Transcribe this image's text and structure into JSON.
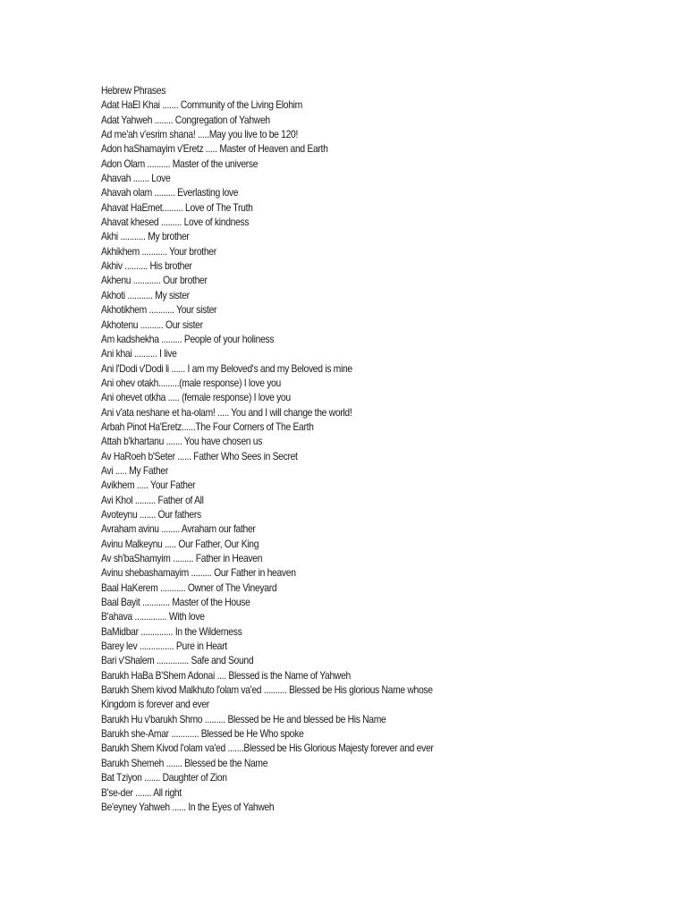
{
  "document": {
    "title": "Hebrew Phrases",
    "entries": [
      "Adat HaEl Khai ....... Community of the Living Elohim",
      "Adat Yahweh ........ Congregation of Yahweh",
      "Ad me'ah v'esrim shana! .....May you live to be 120!",
      "Adon haShamayim v'Eretz ..... Master of Heaven and Earth",
      "Adon Olam .......... Master of the universe",
      "Ahavah ....... Love",
      "Ahavah olam ......... Everlasting love",
      "Ahavat HaEmet......... Love of The Truth",
      "Ahavat khesed ......... Love of kindness",
      "Akhi ........... My brother",
      "Akhikhem ........... Your brother",
      "Akhiv .......... His brother",
      "Akhenu ............ Our brother",
      "Akhoti ........... My sister",
      "Akhotikhem ........... Your sister",
      "Akhotenu .......... Our sister",
      "Am kadshekha ......... People of your holiness",
      "Ani khai .......... I live",
      "Ani l'Dodi v'Dodi li ...... I am my Beloved's and my Beloved is mine",
      "Ani ohev otakh.........(male response) I love you",
      "Ani ohevet otkha ..... (female response) I love you",
      "Ani v'ata neshane et ha-olam! ..... You and I will change the world!",
      "Arbah Pinot Ha'Eretz......The Four Corners of The Earth",
      "Attah b'khartanu ....... You have chosen us",
      "Av HaRoeh b'Seter ...... Father Who Sees in Secret",
      "Avi ..... My Father",
      "Avikhem ..... Your Father",
      "Avi Khol ......... Father of All",
      "Avoteynu ....... Our fathers",
      "Avraham avinu ........ Avraham our father",
      "Avinu Malkeynu ..... Our Father, Our King",
      "Av sh'baShamyim ......... Father in Heaven",
      "Avinu shebashamayim ......... Our Father in heaven",
      "Baal HaKerem ........... Owner of The Vineyard",
      "Baal Bayit ............ Master of the House",
      "B'ahava .............. With love",
      "BaMidbar .............. In the Wilderness",
      "Barey lev ............... Pure in Heart",
      "Bari v'Shalem .............. Safe and Sound",
      "Barukh HaBa B'Shem Adonai .... Blessed is the Name of Yahweh",
      "Barukh Shem kivod Malkhuto l'olam va'ed .......... Blessed be His glorious Name whose Kingdom is forever and ever",
      "Barukh Hu v'barukh Shmo ......... Blessed be He and blessed be His Name",
      "Barukh she-Amar ............ Blessed be He Who spoke",
      "Barukh Shem Kivod l'olam va'ed .......Blessed be His Glorious Majesty forever and ever",
      "Barukh Shemeh ....... Blessed be the Name",
      "Bat Tziyon ....... Daughter of Zion",
      "B'se-der ....... All right",
      "Be'eyney Yahweh ...... In the Eyes of Yahweh"
    ]
  }
}
